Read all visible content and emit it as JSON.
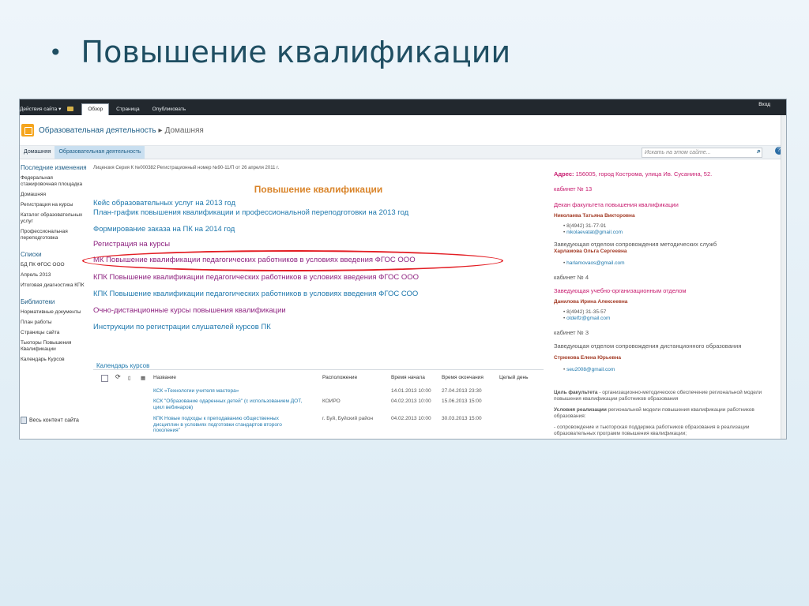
{
  "slide": {
    "bullet": "•",
    "title": "Повышение квалификации"
  },
  "ribbon": {
    "site_actions": "Действия сайта ▾",
    "tabs": [
      "Обзор",
      "Страница",
      "Опубликовать"
    ],
    "login": "Вход"
  },
  "breadcrumb": {
    "site": "Образовательная деятельность",
    "separator": "▸",
    "current": "Домашняя"
  },
  "topnav": {
    "items": [
      "Домашняя",
      "Образовательная деятельность"
    ],
    "search_placeholder": "Искать на этом сайте...",
    "search_icon": "🔍",
    "help_icon": "?"
  },
  "quicklaunch": {
    "recent": "Последние изменения",
    "items": [
      "Федеральная стажировочная площадка",
      "Домашняя",
      "Регистрация на курсы",
      "Каталог образовательных услуг",
      "Профессиональная переподготовка"
    ],
    "lists_head": "Списки",
    "lists": [
      "БД ПК ФГОС ООО",
      "Апрель 2013",
      "Итоговая диагностика КПК"
    ],
    "libs_head": "Библиотеки",
    "libs": [
      "Нормативные документы",
      "План работы",
      "Страницы сайта",
      "Тьюторы Повышения Квалификации",
      "Календарь Курсов"
    ],
    "all_content": "Весь контент сайта"
  },
  "main": {
    "license": "Лицензия Серия К №000382 Регистрационный номер №90-11/П от 26 апреля 2011 г.",
    "heading": "Повышение квалификации",
    "links": [
      "Кейс образовательных услуг на 2013 год",
      "План-график повышения квалификации и профессиональной переподготовки на 2013 год",
      "Формирование заказа на ПК на 2014 год",
      "Регистрация на курсы",
      "МК Повышение квалификации педагогических работников в условиях введения ФГОС ООО",
      "КПК Повышение квалификации педагогических работников в условиях введения ФГОС ООО",
      "КПК Повышение квалификации педагогических работников в условиях введения ФГОС СОО",
      "Очно-дистанционные курсы повышения квалификации",
      "Инструкции по регистрации слушателей курсов ПК"
    ]
  },
  "calendar": {
    "title": "Календарь курсов",
    "columns": [
      "Название",
      "Расположение",
      "Время начала",
      "Время окончания",
      "Целый день"
    ],
    "rows": [
      {
        "name": "КСК «Технологии учителя мастера»",
        "location": "",
        "start": "14.01.2013 10:00",
        "end": "27.04.2013 23:30"
      },
      {
        "name": "КСК \"Образование одаренных детей\" (с использованием ДОТ, цикл вебинаров)",
        "location": "КОИРО",
        "start": "04.02.2013 10:00",
        "end": "15.06.2013 15:00"
      },
      {
        "name": "КПК Новые подходы к преподаванию общественных дисциплин в условиях подготовки стандартов второго поколения\"",
        "location": "г. Буй, Буйский район",
        "start": "04.02.2013 10:00",
        "end": "30.03.2013 15:00"
      }
    ]
  },
  "sidebar": {
    "address_label": "Адрес:",
    "address_value": "156005, город Кострома, улица Ив. Сусанина, 52.",
    "room1": "кабинет № 13",
    "dean_title": "Декан факультета повышения квалификации",
    "dean_name": "Николаева Татьяна Викторовна",
    "dean_phone": "8(4942) 31-77-91",
    "dean_email": "nikolaevatat@gmail.com",
    "head1_title": "Заведующая отделом сопровождения методических служб",
    "head1_name": "Харламова Ольга Сергеевна",
    "head1_email": "harlamovaos@gmail.com",
    "room2": "кабинет № 4",
    "head2_title": "Заведующая учебно-организационным отделом",
    "head2_name": "Данилова Ирина Алексеевна",
    "head2_phone": "8(4942) 31-35-57",
    "head2_email": "otdelfz@gmail.com",
    "room3": "кабинет № 3",
    "head3_title": "Заведующая отделом сопровождения дистанционного образования",
    "head3_name": "Стрюкова Елена Юрьевна",
    "head3_email": "seu2008@gmail.com",
    "goal_label": "Цель факультета",
    "goal_text": " - организационно-методическое обеспечение региональной модели повышения квалификации работников образования",
    "cond_label": "Условия реализации",
    "cond_text": " региональной модели повышения квалификации работников образования:",
    "bullet1": "- сопровождение и тьюторская поддержка работников образования в реализации образовательных программ повышения квалификации;"
  },
  "colors": {
    "accent_red": "#e31e24",
    "link_blue": "#1e78ad",
    "link_magenta": "#8e2380",
    "heading_orange": "#d9842a"
  }
}
